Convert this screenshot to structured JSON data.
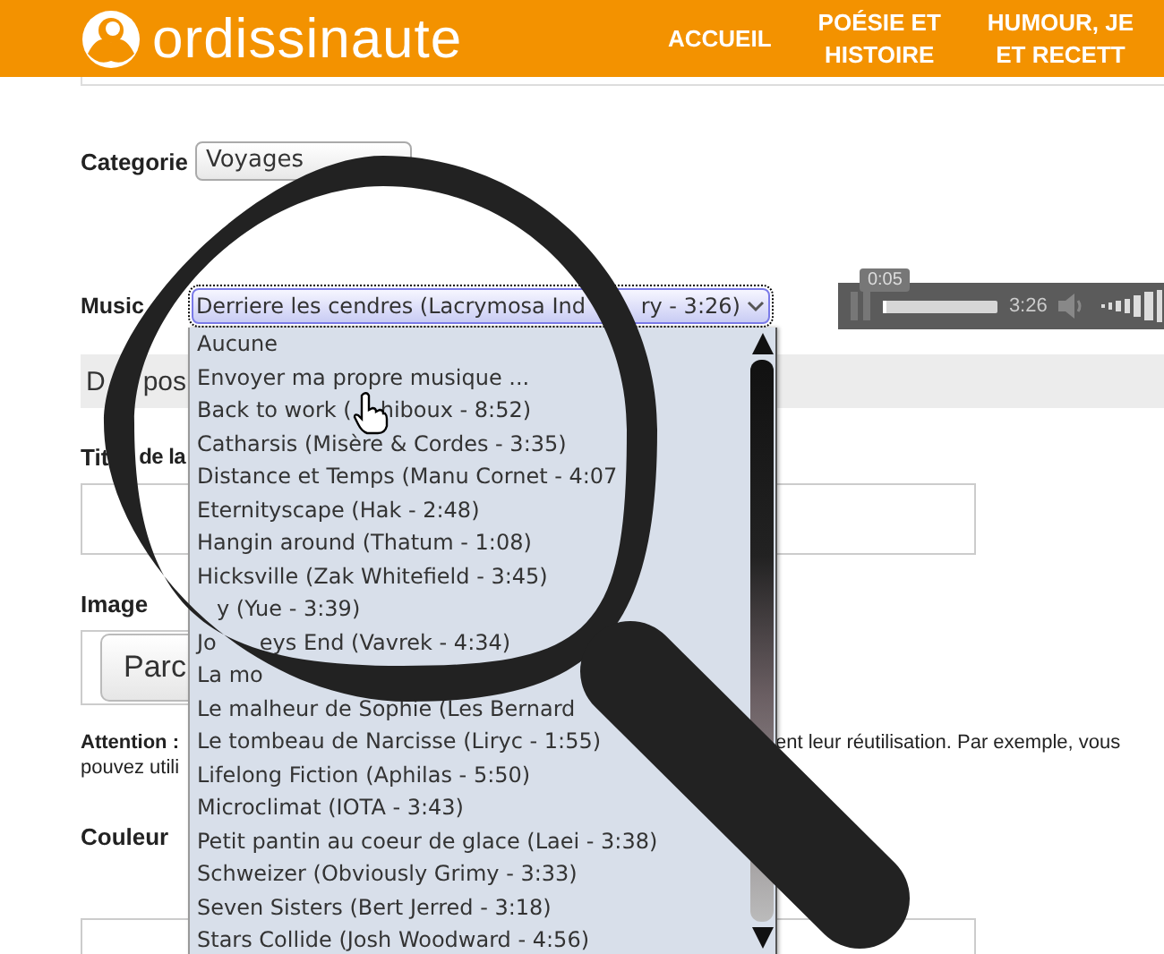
{
  "header": {
    "logo_text": "ordissinaute",
    "nav": [
      {
        "lines": [
          "ACCUEIL"
        ]
      },
      {
        "lines": [
          "POÉSIE ET",
          "HISTOIRE"
        ]
      },
      {
        "lines": [
          "HUMOUR, JE",
          "ET RECETT"
        ]
      }
    ]
  },
  "category": {
    "label": "Categorie",
    "value": "Voyages"
  },
  "music": {
    "label": "Music",
    "value": "Derriere les cendres (Lacrymosa Ind",
    "value_rest": "ry - 3:26)"
  },
  "player": {
    "tooltip": "0:05",
    "duration": "3:26",
    "level": 0.02
  },
  "dropdown": [
    {
      "text": "Aucune"
    },
    {
      "text": "Envoyer ma propre musique ..."
    },
    {
      "text": "Back to work (",
      "rest": "hiboux - 8:52)"
    },
    {
      "text": "Catharsis (Misère & Cordes - 3:35)"
    },
    {
      "text": "Distance et Temps (Manu Cornet - 4:07"
    },
    {
      "text": "Eternityscape (Hak - 2:48)"
    },
    {
      "text": "Hangin around (Thatum - 1:08)"
    },
    {
      "text": "Hicksville (Zak Whitefield - 3:45)"
    },
    {
      "rest": "y (Yue - 3:39)"
    },
    {
      "text": "Jo",
      "rest": "eys End (Vavrek - 4:34)"
    },
    {
      "text": "La mo"
    },
    {
      "text": "Le malheur de Sophie (Les Bernard"
    },
    {
      "text": "Le tombeau de Narcisse (Liryc - 1:55)"
    },
    {
      "text": "Lifelong Fiction (Aphilas - 5:50)"
    },
    {
      "text": "Microclimat (IOTA - 3:43)"
    },
    {
      "text": "Petit pantin au coeur de glace (Laei - 3:38)"
    },
    {
      "text": "Schweizer (Obviously Grimy - 3:33)"
    },
    {
      "text": "Seven Sisters (Bert Jerred - 3:18)"
    },
    {
      "text": "Stars Collide (Josh Woodward - 4:56)"
    }
  ],
  "section": {
    "text": "D",
    "rest": "pos"
  },
  "title_field": {
    "label": "Tit",
    "label_rest": "de la"
  },
  "image": {
    "label": "Image",
    "button": "Parc"
  },
  "attention": {
    "label": "Attention :",
    "tail": "ent leur réutilisation. Par exemple, vous",
    "line2": "pouvez utili"
  },
  "color": {
    "label": "Couleur"
  }
}
